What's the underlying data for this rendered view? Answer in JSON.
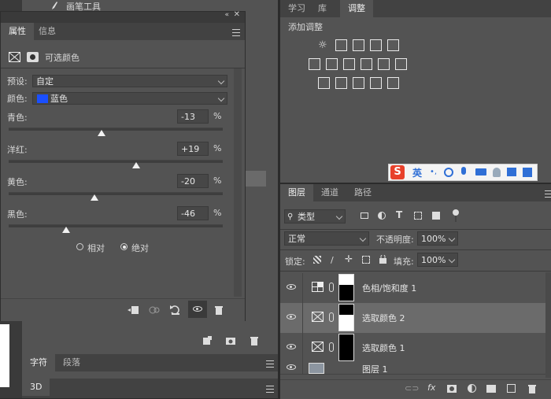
{
  "top_left_strip": {
    "tool_label": "画笔工具"
  },
  "properties_panel": {
    "tabs": [
      "属性",
      "信息"
    ],
    "panel_title": "可选颜色",
    "preset_label": "预设:",
    "preset_value": "自定",
    "color_label": "颜色:",
    "color_value": "蓝色",
    "color_swatch": "#1a4fff",
    "sliders": [
      {
        "label": "青色:",
        "value": "-13",
        "unit": "%",
        "level": -13
      },
      {
        "label": "洋红:",
        "value": "+19",
        "unit": "%",
        "level": 19
      },
      {
        "label": "黄色:",
        "value": "-20",
        "unit": "%",
        "level": -20
      },
      {
        "label": "黑色:",
        "value": "-46",
        "unit": "%",
        "level": -46
      }
    ],
    "method_options": [
      "相对",
      "绝对"
    ],
    "method_selected": "绝对"
  },
  "lower_left": {
    "tabs": [
      "字符",
      "段落"
    ],
    "tab_3d": "3D"
  },
  "right_top": {
    "tabs": [
      "学习",
      "库",
      "调整"
    ],
    "section_title": "添加调整"
  },
  "ime_bar": {
    "logo": "S",
    "lang": "英"
  },
  "layers_panel": {
    "tabs": [
      "图层",
      "通道",
      "路径"
    ],
    "filter_label": "类型",
    "blend_mode": "正常",
    "opacity_label": "不透明度:",
    "opacity_value": "100%",
    "lock_label": "锁定:",
    "fill_label": "填充:",
    "fill_value": "100%",
    "layers": [
      {
        "name": "色相/饱和度 1",
        "kind": "hue"
      },
      {
        "name": "选取颜色 2",
        "kind": "selective",
        "selected": true
      },
      {
        "name": "选取颜色 1",
        "kind": "selective"
      },
      {
        "name": "图层 1",
        "kind": "pixel"
      }
    ]
  },
  "icons": [
    "brush-icon",
    "menu-icon",
    "mask-icon",
    "eye-icon",
    "trash-icon",
    "chain-icon",
    "search-icon"
  ]
}
